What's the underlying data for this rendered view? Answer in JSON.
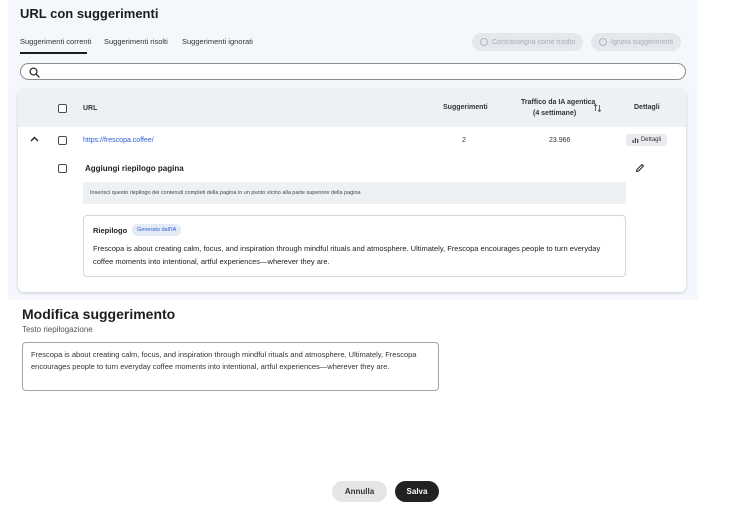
{
  "header": {
    "title": "URL con suggerimenti"
  },
  "tabs": [
    {
      "label": "Suggerimenti correnti",
      "active": true
    },
    {
      "label": "Suggerimenti risolti"
    },
    {
      "label": "Suggerimenti ignorati"
    }
  ],
  "actions": {
    "mark_resolved": "Contrassegna come risolto",
    "ignore": "Ignora suggerimenti"
  },
  "table": {
    "columns": {
      "url": "URL",
      "suggestions": "Suggerimenti",
      "traffic_line1": "Traffico da IA agentica",
      "traffic_line2": "(4 settimane)",
      "details": "Dettagli"
    },
    "row": {
      "url": "https://frescopa.coffee/",
      "suggestions": "2",
      "traffic": "23.966",
      "details_button": "Dettagli"
    },
    "suggestion": {
      "title": "Aggiungi riepilogo pagina",
      "description": "Inserisci questo riepilogo dei contenuti completi della pagina in un punto vicino alla parte superiore della pagina",
      "summary_label": "Riepilogo",
      "ai_badge": "Generato dall'IA",
      "summary_text": "Frescopa is about creating calm, focus, and inspiration through mindful rituals and atmosphere. Ultimately, Frescopa encourages people to turn everyday coffee moments into intentional, artful experiences—wherever they are."
    }
  },
  "edit": {
    "title": "Modifica suggerimento",
    "field_label": "Testo riepilogazione",
    "field_value": "Frescopa is about creating calm, focus, and inspiration through mindful rituals and atmosphere. Ultimately, Frescopa encourages people to turn everyday coffee moments into intentional, artful experiences—wherever they are."
  },
  "footer": {
    "cancel": "Annulla",
    "save": "Salva"
  }
}
